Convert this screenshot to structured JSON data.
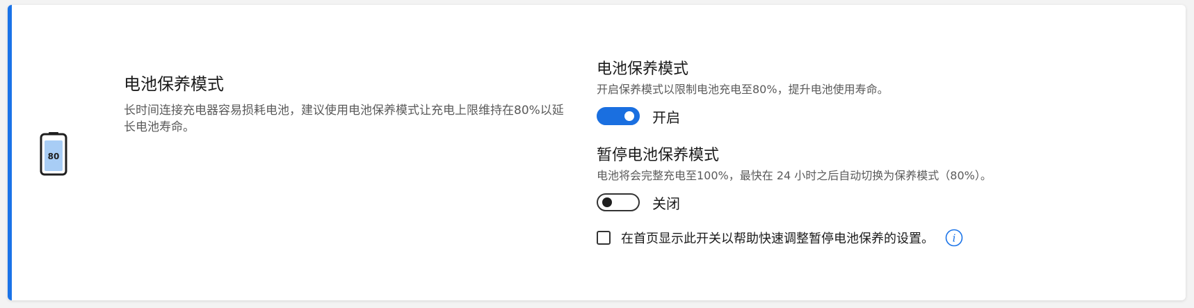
{
  "battery_icon": {
    "level_text": "80",
    "colors": {
      "outline": "#1f1f1f",
      "fill": "#a8cdf5"
    }
  },
  "left": {
    "title": "电池保养模式",
    "description": "长时间连接充电器容易损耗电池，建议使用电池保养模式让充电上限维持在80%以延长电池寿命。"
  },
  "right": {
    "section1": {
      "title": "电池保养模式",
      "description": "开启保养模式以限制电池充电至80%，提升电池使用寿命。",
      "toggle_state": "on",
      "toggle_label": "开启"
    },
    "section2": {
      "title": "暂停电池保养模式",
      "description": "电池将会完整充电至100%，最快在 24 小时之后自动切换为保养模式（80%）。",
      "toggle_state": "off",
      "toggle_label": "关闭"
    },
    "checkbox": {
      "checked": false,
      "label": "在首页显示此开关以帮助快速调整暂停电池保养的设置。"
    }
  },
  "colors": {
    "accent": "#1a73e8",
    "toggle_on": "#1a6fe0",
    "info_icon": "#1a73e8"
  },
  "icons": {
    "battery": "battery-icon",
    "info": "info-icon"
  }
}
